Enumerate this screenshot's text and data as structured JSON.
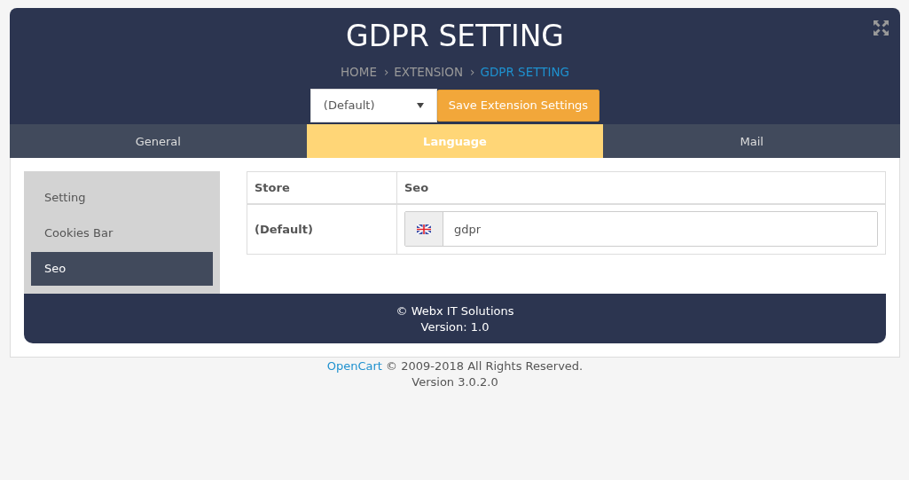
{
  "header": {
    "title": "GDPR SETTING",
    "breadcrumb": [
      {
        "label": "HOME",
        "selected": false
      },
      {
        "separator": "›",
        "label": "EXTENSION",
        "selected": false
      },
      {
        "separator": "›",
        "label": "GDPR SETTING",
        "selected": true
      }
    ],
    "store_select": {
      "value": "(Default)"
    },
    "save_button": "Save Extension Settings"
  },
  "tabs": [
    {
      "label": "General",
      "selected": false
    },
    {
      "label": "Language",
      "selected": true
    },
    {
      "label": "Mail",
      "selected": false
    }
  ],
  "sidebar": {
    "items": [
      {
        "label": "Setting",
        "selected": false
      },
      {
        "label": "Cookies Bar",
        "selected": false
      },
      {
        "label": "Seo",
        "selected": true
      }
    ]
  },
  "table": {
    "columns": [
      "Store",
      "Seo"
    ],
    "rows": [
      {
        "store": "(Default)",
        "seo": "gdpr"
      }
    ]
  },
  "panel_footer": {
    "copyright": "© Webx IT Solutions",
    "version": "Version: 1.0"
  },
  "page_footer": {
    "link": "OpenCart",
    "text": "© 2009-2018 All Rights Reserved.",
    "version": "Version 3.0.2.0"
  }
}
